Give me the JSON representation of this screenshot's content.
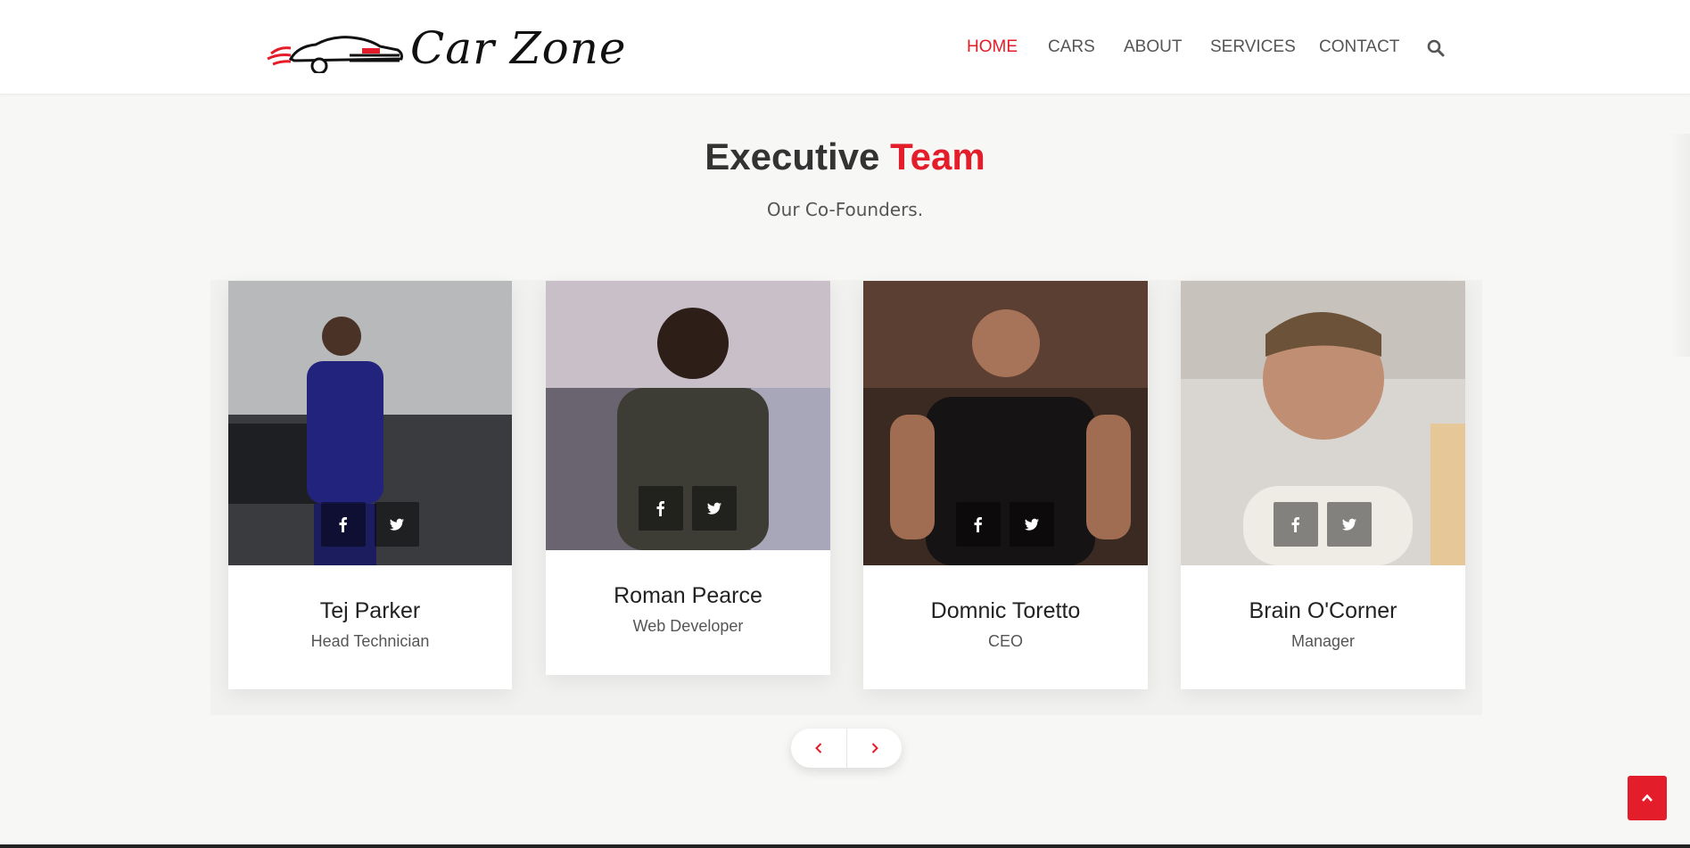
{
  "brand": {
    "logo_text": "Car Zone",
    "accent_color": "#e31d2a"
  },
  "nav": {
    "items": [
      {
        "label": "HOME",
        "active": true
      },
      {
        "label": "CARS",
        "active": false
      },
      {
        "label": "ABOUT",
        "active": false
      },
      {
        "label": "SERVICES",
        "active": false
      },
      {
        "label": "CONTACT",
        "active": false
      }
    ],
    "search_icon": "search-icon"
  },
  "section": {
    "title_part1": "Executive",
    "title_part2": "Team",
    "subtitle": "Our Co-Founders."
  },
  "team": [
    {
      "name": "Tej Parker",
      "role": "Head Technician"
    },
    {
      "name": "Roman Pearce",
      "role": "Web Developer"
    },
    {
      "name": "Domnic Toretto",
      "role": "CEO"
    },
    {
      "name": "Brain O'Corner",
      "role": "Manager"
    }
  ],
  "social_icons": [
    "facebook-icon",
    "twitter-icon"
  ],
  "carousel_nav": {
    "prev_icon": "chevron-left-icon",
    "next_icon": "chevron-right-icon"
  },
  "back_to_top_icon": "chevron-up-icon"
}
